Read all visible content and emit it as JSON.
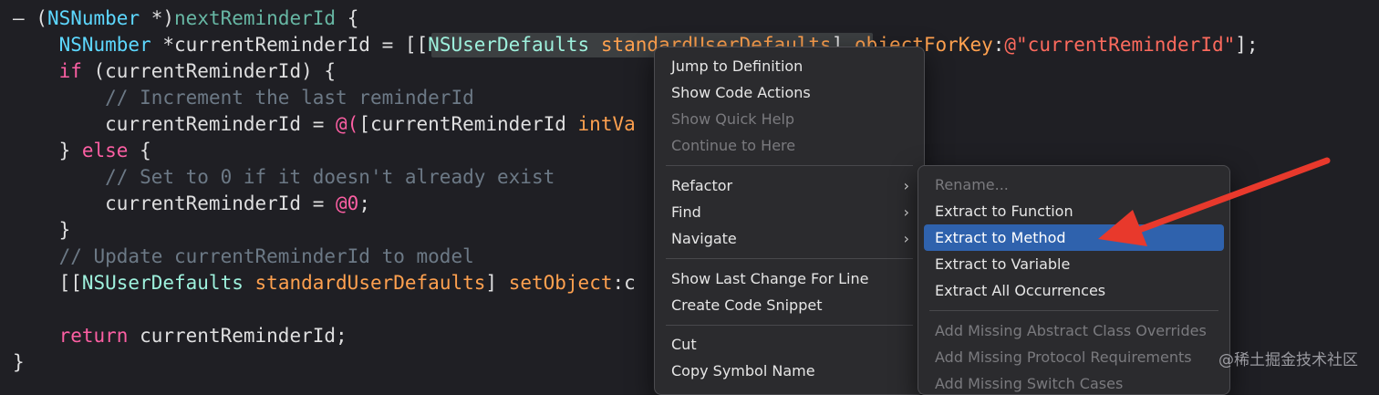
{
  "code": {
    "l1": {
      "a": "– (",
      "b": "NSNumber",
      "c": " *)",
      "d": "nextReminderId",
      "e": " {"
    },
    "l2": {
      "a": "    ",
      "b": "NSNumber",
      "c": " *currentReminderId = [[",
      "d": "NSUserDefaults",
      "e": " ",
      "f": "standardUserDefaults",
      "g": "] ",
      "h": "objectForKey",
      "i": ":",
      "j": "@\"currentReminderId\"",
      "k": "];"
    },
    "l3": {
      "a": "    ",
      "b": "if",
      "c": " (currentReminderId) {"
    },
    "l4": {
      "a": "        ",
      "b": "// Increment the last reminderId"
    },
    "l5": {
      "a": "        currentReminderId = ",
      "b": "@(",
      "c": "[currentReminderId ",
      "d": "intVa"
    },
    "l6": {
      "a": "    } ",
      "b": "else",
      "c": " {"
    },
    "l7": {
      "a": "        ",
      "b": "// Set to 0 if it doesn't already exist"
    },
    "l8": {
      "a": "        currentReminderId = ",
      "b": "@0",
      "c": ";"
    },
    "l9": {
      "a": "    }"
    },
    "l10": {
      "a": "    ",
      "b": "// Update currentReminderId to model"
    },
    "l11": {
      "a": "    [[",
      "b": "NSUserDefaults",
      "c": " ",
      "d": "standardUserDefaults",
      "e": "] ",
      "f": "setObject",
      "g": ":c"
    },
    "l12": {
      "a": ""
    },
    "l13": {
      "a": "    ",
      "b": "return",
      "c": " currentReminderId;"
    },
    "l14": {
      "a": "}"
    }
  },
  "context_menu": {
    "jump_to_definition": "Jump to Definition",
    "show_code_actions": "Show Code Actions",
    "show_quick_help": "Show Quick Help",
    "continue_to_here": "Continue to Here",
    "refactor": "Refactor",
    "find": "Find",
    "navigate": "Navigate",
    "show_last_change": "Show Last Change For Line",
    "create_code_snippet": "Create Code Snippet",
    "cut": "Cut",
    "copy_symbol_name": "Copy Symbol Name"
  },
  "refactor_submenu": {
    "rename": "Rename...",
    "extract_function": "Extract to Function",
    "extract_method": "Extract to Method",
    "extract_variable": "Extract to Variable",
    "extract_all": "Extract All Occurrences",
    "add_abstract": "Add Missing Abstract Class Overrides",
    "add_protocol": "Add Missing Protocol Requirements",
    "add_switch": "Add Missing Switch Cases"
  },
  "icons": {
    "chevron": "chevron-right-icon",
    "arrow": "red-arrow-annotation"
  },
  "colors": {
    "selection": "#2f62ad",
    "arrow": "#e8392c",
    "keyword": "#fc5fa3",
    "string": "#fc6a5d"
  },
  "watermark": "@稀土掘金技术社区"
}
